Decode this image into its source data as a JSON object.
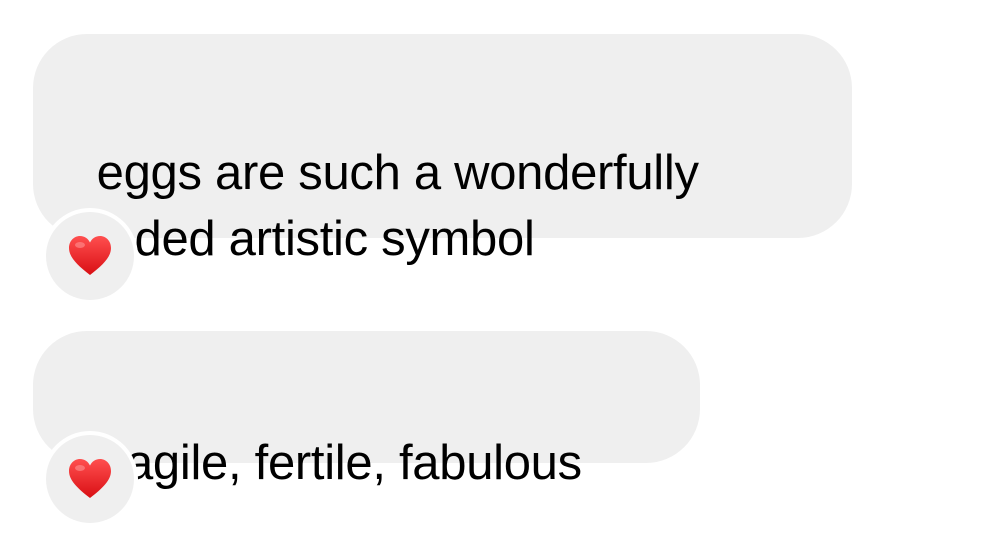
{
  "messages": [
    {
      "text": "eggs are such a wonderfully\nloaded artistic symbol",
      "reaction": {
        "icon": "heart-icon",
        "glyph": "❤️"
      }
    },
    {
      "text": "fragile, fertile, fabulous",
      "reaction": {
        "icon": "heart-icon",
        "glyph": "❤️"
      }
    }
  ],
  "colors": {
    "bubble_background": "#efefef",
    "text": "#000000",
    "heart": "#e8161c",
    "page_background": "#ffffff"
  }
}
